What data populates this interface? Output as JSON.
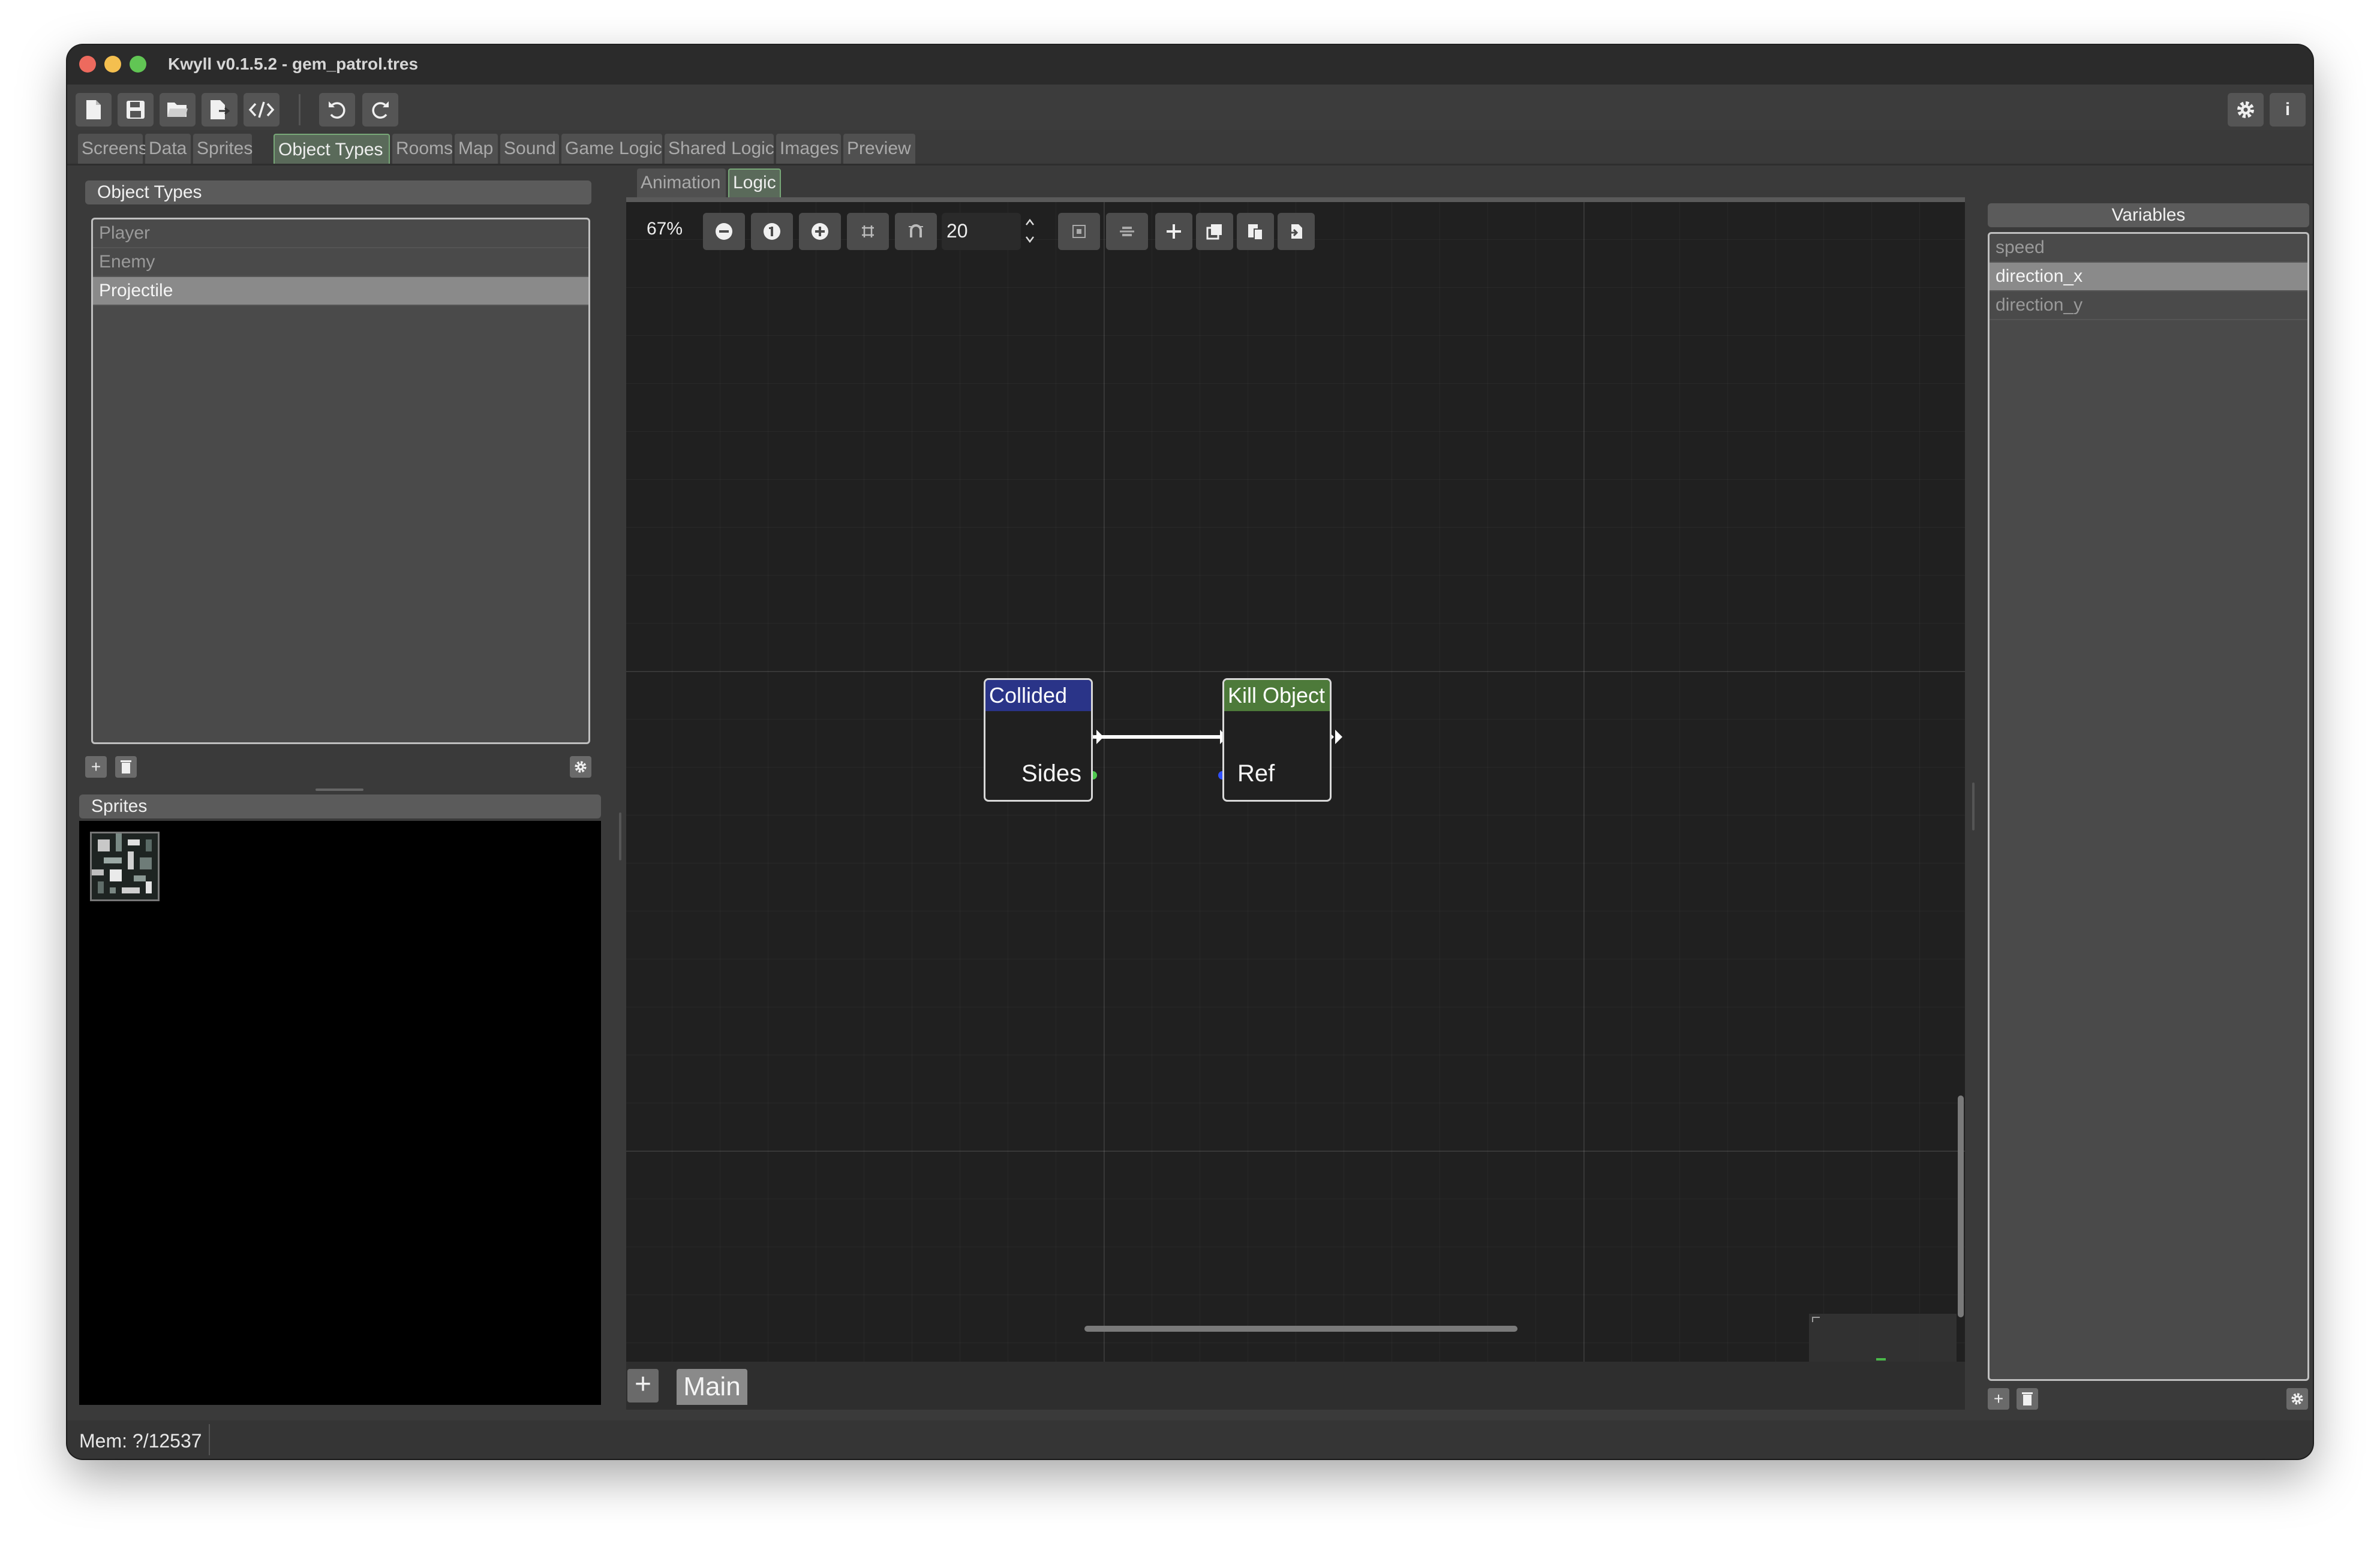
{
  "window": {
    "title": "Kwyll v0.1.5.2 - gem_patrol.tres"
  },
  "toolbar": {
    "new": "new-file-icon",
    "save": "save-icon",
    "open": "open-folder-icon",
    "export": "export-icon",
    "code": "code-icon",
    "undo": "undo-icon",
    "redo": "redo-icon",
    "settings": "gear-icon",
    "info_label": "i"
  },
  "main_tabs": [
    "Screens",
    "Data",
    "Sprites",
    "Object Types",
    "Rooms",
    "Map",
    "Sound",
    "Game Logic",
    "Shared Logic",
    "Images",
    "Preview"
  ],
  "active_main_tab": "Object Types",
  "object_types": {
    "header": "Object Types",
    "items": [
      "Player",
      "Enemy",
      "Projectile"
    ],
    "selected": "Projectile"
  },
  "sprites": {
    "header": "Sprites"
  },
  "sub_tabs": [
    "Animation",
    "Logic"
  ],
  "active_sub_tab": "Logic",
  "graph": {
    "zoom": "67%",
    "snap_value": "20",
    "nodes": [
      {
        "title": "Collided",
        "port": "Sides",
        "color": "#2a3488"
      },
      {
        "title": "Kill Object",
        "port": "Ref",
        "color": "#4d7a3a"
      }
    ]
  },
  "bottom": {
    "add_label": "+",
    "main_tab": "Main"
  },
  "variables": {
    "header": "Variables",
    "items": [
      "speed",
      "direction_x",
      "direction_y"
    ],
    "selected": "direction_x"
  },
  "status": {
    "mem": "Mem: ?/12537"
  },
  "colors": {
    "accent_green": "#78a878",
    "port_green": "#4ec94e",
    "port_blue": "#3050ff"
  }
}
